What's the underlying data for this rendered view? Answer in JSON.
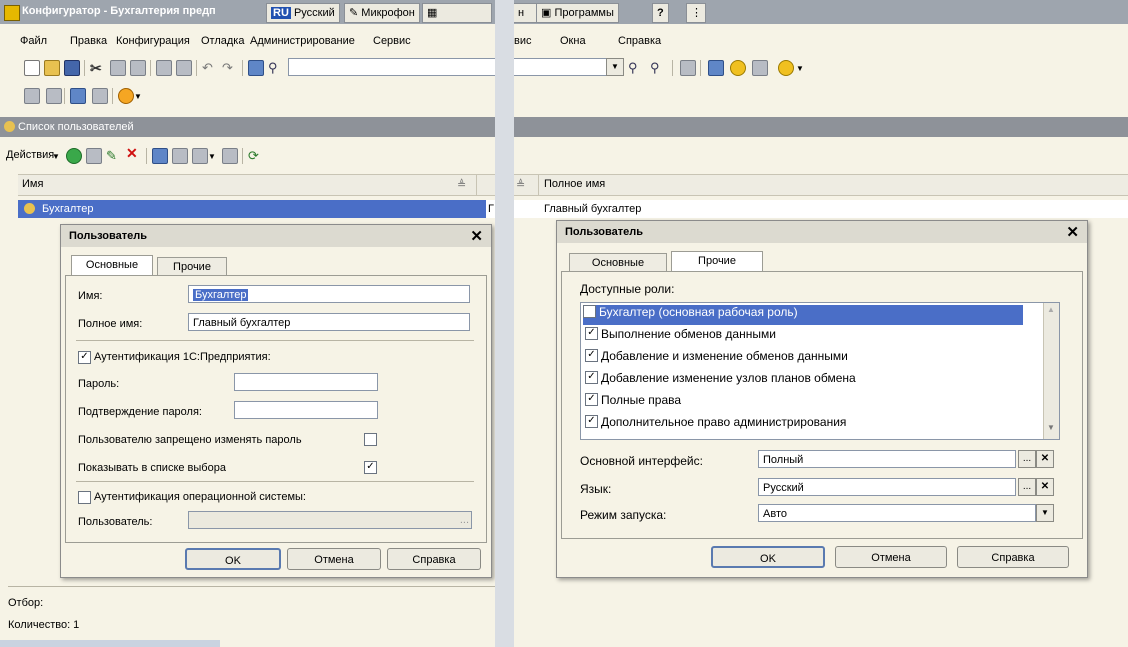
{
  "titlebar": {
    "title": "Конфигуратор - Бухгалтерия предп",
    "lang_badge": "RU",
    "lang_label": "Русский",
    "mic_label": "Микрофон",
    "partial_label": "н",
    "programs_label": "Программы",
    "help_badge": "?"
  },
  "menu": {
    "file": "Файл",
    "edit": "Правка",
    "config": "Конфигурация",
    "debug": "Отладка",
    "admin": "Администрирование",
    "service": "Сервис",
    "service_tail": "вис",
    "windows": "Окна",
    "help": "Справка"
  },
  "subwindow": {
    "title": "Список пользователей",
    "actions_label": "Действия"
  },
  "grid": {
    "col_name": "Имя",
    "col_fullname": "Полное имя",
    "row_name": "Бухгалтер",
    "row_fullname": "Главный бухгалтер",
    "row_partial": "Г"
  },
  "footer": {
    "filter": "Отбор:",
    "count": "Количество: 1"
  },
  "dialog_left": {
    "title": "Пользователь",
    "tab_main": "Основные",
    "tab_other": "Прочие",
    "name_label": "Имя:",
    "name_value": "Бухгалтер",
    "fullname_label": "Полное имя:",
    "fullname_value": "Главный бухгалтер",
    "auth_1c_label": "Аутентификация 1С:Предприятия:",
    "password_label": "Пароль:",
    "confirm_label": "Подтверждение пароля:",
    "forbid_change_label": "Пользователю запрещено изменять пароль",
    "show_in_list_label": "Показывать в списке выбора",
    "auth_os_label": "Аутентификация операционной системы:",
    "os_user_label": "Пользователь:",
    "ok": "OK",
    "cancel": "Отмена",
    "help": "Справка"
  },
  "dialog_right": {
    "title": "Пользователь",
    "tab_main": "Основные",
    "tab_other": "Прочие",
    "roles_label": "Доступные роли:",
    "roles": [
      "Бухгалтер (основная рабочая роль)",
      "Выполнение обменов данными",
      "Добавление и изменение обменов данными",
      "Добавление изменение узлов планов обмена",
      "Полные права",
      "Дополнительное право администрирования"
    ],
    "interface_label": "Основной интерфейс:",
    "interface_value": "Полный",
    "language_label": "Язык:",
    "language_value": "Русский",
    "launch_label": "Режим запуска:",
    "launch_value": "Авто",
    "ok": "OK",
    "cancel": "Отмена",
    "help": "Справка"
  },
  "glyphs": {
    "close": "✕",
    "check": "✓",
    "ellipsis": "...",
    "clear": "✕",
    "dropdown": "▼"
  }
}
